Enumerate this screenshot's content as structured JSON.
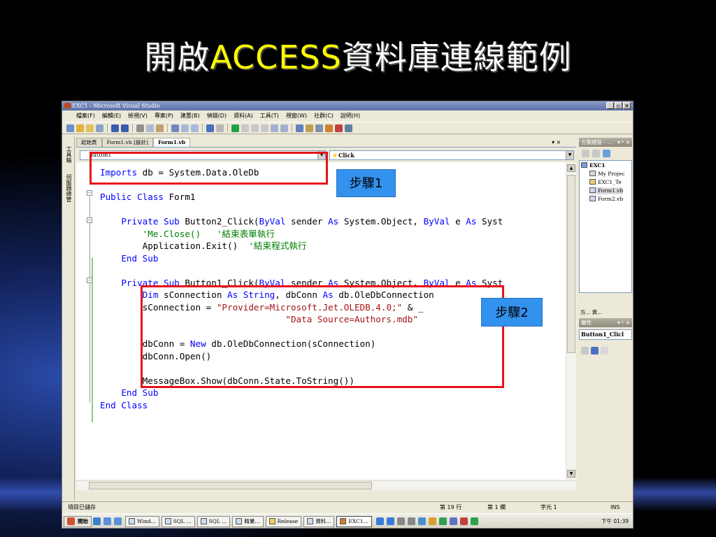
{
  "slide": {
    "title_part1": "開啟",
    "title_part2": "ACCESS",
    "title_part3": "資料庫連線範例"
  },
  "window": {
    "title": "EXC1 - Microsoft Visual Studio",
    "min": "_",
    "max": "▫",
    "close": "×"
  },
  "menu": [
    "檔案(F)",
    "編輯(E)",
    "檢視(V)",
    "專案(P)",
    "建置(B)",
    "偵錯(D)",
    "資料(A)",
    "工具(T)",
    "視窗(W)",
    "社群(C)",
    "說明(H)"
  ],
  "left_strip": [
    "工具箱",
    "伺服器總管"
  ],
  "tabs": [
    "起始頁",
    "Form1.vb [設計]",
    "Form1.vb"
  ],
  "tab_controls": "▾ ×",
  "combos": {
    "left": "Button1",
    "right": "Click"
  },
  "code": {
    "l1_kw": "Imports",
    "l1_rest": " db = System.Data.OleDb",
    "l2_kw": "Public Class",
    "l2_rest": " Form1",
    "l3_a": "Private Sub",
    "l3_b": " Button2_Click(",
    "l3_c": "ByVal",
    "l3_d": " sender ",
    "l3_e": "As",
    "l3_f": " System.Object, ",
    "l3_g": "ByVal",
    "l3_h": " e ",
    "l3_i": "As",
    "l3_j": " Syst",
    "l4": "'Me.Close()   '結束表單執行",
    "l5_a": "Application.Exit()  ",
    "l5_b": "'結束程式執行",
    "l6": "End Sub",
    "l7_a": "Private Sub",
    "l7_b": " Button1_Click(",
    "l7_c": "ByVal",
    "l7_d": " sender ",
    "l7_e": "As",
    "l7_f": " System.Object, ",
    "l7_g": "ByVal",
    "l7_h": " e ",
    "l7_i": "As",
    "l7_j": " Syst",
    "l8_a": "Dim",
    "l8_b": " sConnection ",
    "l8_c": "As",
    "l8_d": " ",
    "l8_e": "String",
    ", ": "",
    "l8_f": ", dbConn ",
    "l8_g": "As",
    "l8_h": " db.OleDbConnection",
    "l9_a": "sConnection = ",
    "l9_b": "\"Provider=Microsoft.Jet.OLEDB.4.0;\"",
    "l9_c": " & _",
    "l10": "\"Data Source=Authors.mdb\"",
    "l11_a": "dbConn = ",
    "l11_b": "New",
    "l11_c": " db.OleDbConnection(sConnection)",
    "l12": "dbConn.Open()",
    "l13": "MessageBox.Show(dbConn.State.ToString())",
    "l14": "End Sub",
    "l15": "End Class"
  },
  "solution_panel": {
    "title": "方案總管 - ...",
    "controls": "▾ ᵖ ×",
    "items": [
      "EXC1",
      "My Projec",
      "EXC1_Te",
      "Form1.vb",
      "Form2.vb"
    ]
  },
  "pane_tabs": [
    "方...",
    "資..."
  ],
  "properties": {
    "title": "屬性",
    "controls": "▾ ᵖ ×",
    "object": "Button1_Clicl"
  },
  "status": {
    "message": "項目已儲存",
    "line": "第 19 行",
    "col": "第 1 欄",
    "char": "字元 1",
    "mode": "INS"
  },
  "taskbar": {
    "start": "開始",
    "tasks": [
      "Wind...",
      "SQL ...",
      "SQL ...",
      "精業...",
      "Release",
      "資料...",
      "EXC1..."
    ],
    "clock": "下午 01:39"
  },
  "callouts": {
    "step1": "步驟1",
    "step2": "步驟2"
  },
  "colors": {
    "callout_bg": "#3392ee",
    "highlight_box": "#e8131b",
    "keyword": "#0000ff",
    "comment": "#008000",
    "string": "#a31515",
    "title_accent": "#ffff00"
  }
}
